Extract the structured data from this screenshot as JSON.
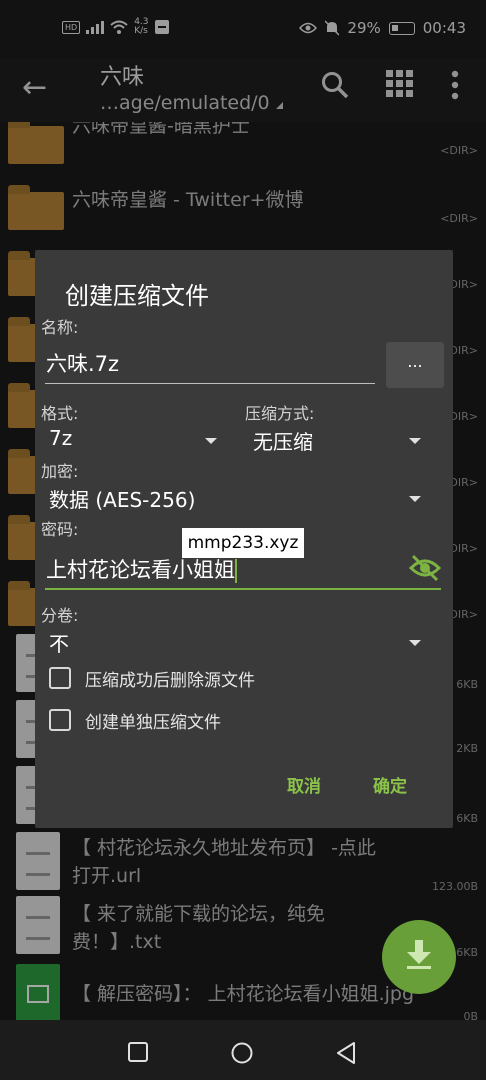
{
  "status_bar": {
    "hd": "HD",
    "net_speed": "4.3",
    "net_unit": "K/s",
    "battery_percent": "29%",
    "time": "00:43"
  },
  "toolbar": {
    "title": "六味",
    "path": "…age/emulated/0",
    "icons": [
      "back-arrow-icon",
      "search-icon",
      "grid-icon",
      "more-vert-icon"
    ]
  },
  "files": [
    {
      "name": "六味帝皇酱-暗黑护士",
      "meta": "<DIR>",
      "type": "folder"
    },
    {
      "name": "六味帝皇酱 - Twitter+微博",
      "meta": "<DIR>",
      "type": "folder"
    },
    {
      "name": "",
      "meta": "<DIR>",
      "type": "folder"
    },
    {
      "name": "",
      "meta": "<DIR>",
      "type": "folder"
    },
    {
      "name": "",
      "meta": "<DIR>",
      "type": "folder"
    },
    {
      "name": "",
      "meta": "<DIR>",
      "type": "folder"
    },
    {
      "name": "",
      "meta": "<DIR>",
      "type": "folder"
    },
    {
      "name": "",
      "meta": "<DIR>",
      "type": "folder"
    },
    {
      "name": "",
      "meta": "6KB",
      "type": "doc"
    },
    {
      "name": "",
      "meta": "2KB",
      "type": "doc"
    },
    {
      "name": "",
      "meta": "6KB",
      "type": "doc"
    },
    {
      "name": "【 村花论坛永久地址发布页】 -点此",
      "name2": "打开.url",
      "meta": "123.00B",
      "type": "doc"
    },
    {
      "name": "【 来了就能下载的论坛，纯免",
      "name2": "费！】.txt",
      "meta": "6KB",
      "type": "doc"
    },
    {
      "name": "【 解压密码】： 上村花论坛看小姐姐.jpg",
      "meta": "0B",
      "type": "image"
    }
  ],
  "dialog": {
    "title": "创建压缩文件",
    "name_label": "名称:",
    "name_value": "六味.7z",
    "browse_label": "...",
    "format_label": "格式:",
    "format_value": "7z",
    "compression_label": "压缩方式:",
    "compression_value": "无压缩",
    "encryption_label": "加密:",
    "encryption_value": "数据 (AES-256)",
    "password_label": "密码:",
    "password_value": "上村花论坛看小姐姐",
    "volume_label": "分卷:",
    "volume_value": "不",
    "checkbox_delete": "压缩成功后删除源文件",
    "checkbox_separate": "创建单独压缩文件",
    "cancel": "取消",
    "ok": "确定"
  },
  "watermark": "mmp233.xyz",
  "colors": {
    "accent": "#8bc34a",
    "fab": "#689f38",
    "folder": "#b8863a",
    "dialog_bg": "#3a3a3a"
  }
}
